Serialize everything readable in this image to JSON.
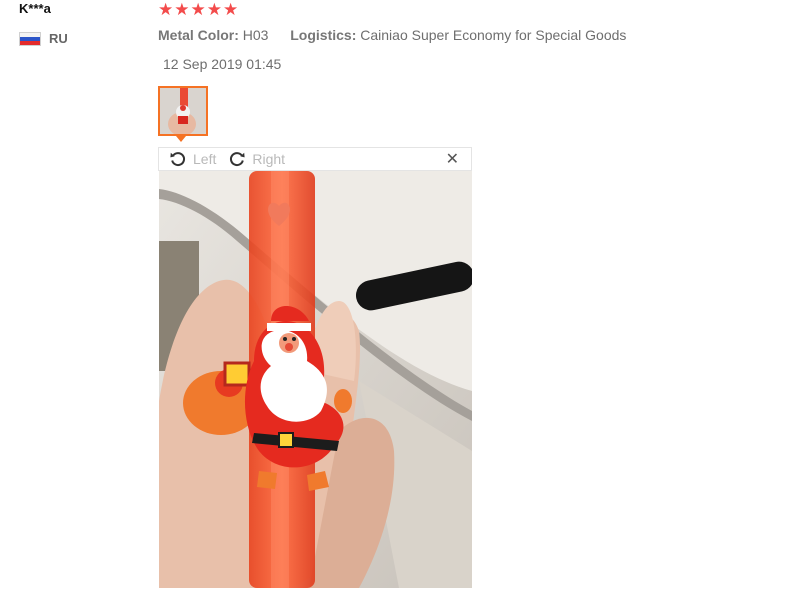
{
  "review": {
    "reviewer_name": "K***a",
    "country_code": "RU",
    "rating": 5,
    "stars": [
      "★",
      "★",
      "★",
      "★",
      "★"
    ],
    "metal_color_label": "Metal Color:",
    "metal_color_value": "H03",
    "logistics_label": "Logistics:",
    "logistics_value": "Cainiao Super Economy for Special Goods",
    "date": "12 Sep 2019 01:45"
  },
  "viewer": {
    "rotate_left_label": "Left",
    "rotate_right_label": "Right",
    "close_glyph": "✕"
  },
  "colors": {
    "star": "#f34b4b",
    "accent": "#f57224"
  },
  "icons": [
    "rotate-left-icon",
    "rotate-right-icon",
    "close-icon",
    "flag-ru-icon"
  ]
}
